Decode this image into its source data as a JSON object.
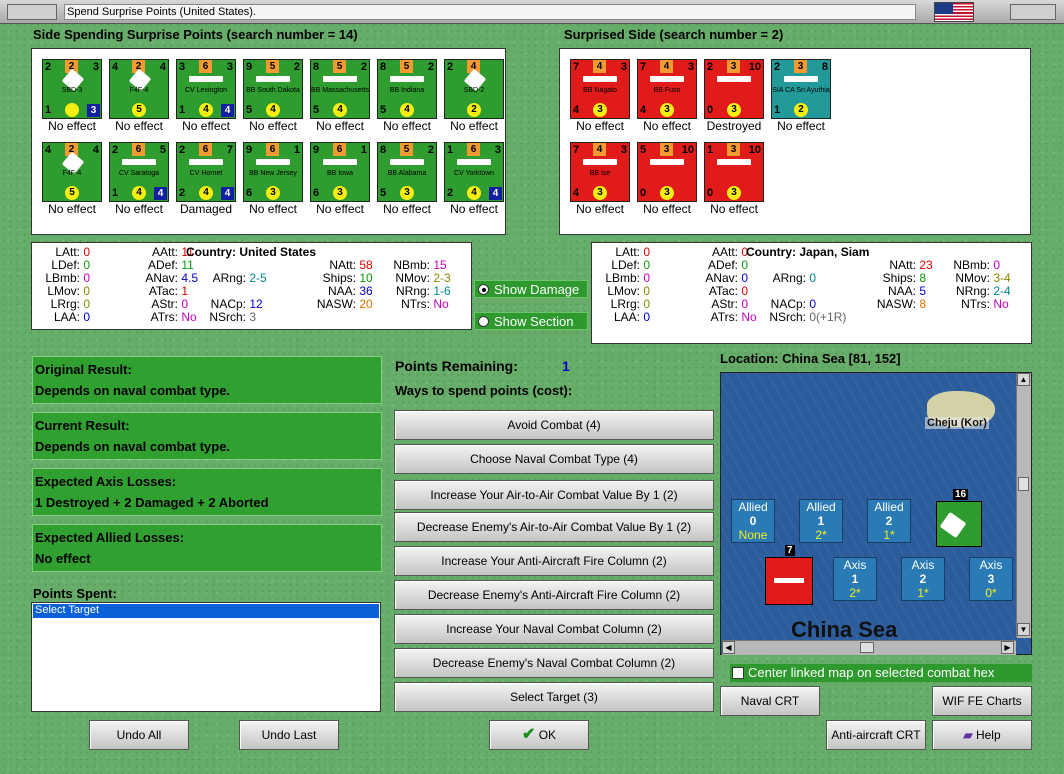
{
  "window": {
    "title": "Spend Surprise Points (United States)."
  },
  "spending": {
    "header": "Side Spending Surprise Points (search number = 14)"
  },
  "surprised": {
    "header": "Surprised Side (search number = 2)"
  },
  "spend_units": [
    {
      "color": "g",
      "kind": "plane",
      "tl": "2",
      "tc": "2",
      "tr": "3",
      "bl": "1",
      "br": "",
      "name": "SBD-3",
      "extra": "3",
      "res": "No effect"
    },
    {
      "color": "g",
      "kind": "plane",
      "tl": "4",
      "tc": "2",
      "tr": "4",
      "bl": "",
      "br": "5",
      "name": "F4F-4",
      "extra": "",
      "res": "No effect"
    },
    {
      "color": "g",
      "kind": "ship",
      "tl": "3",
      "tc": "6",
      "tr": "3",
      "bl": "1",
      "br": "4",
      "name": "CV Lexington",
      "extra": "4",
      "res": "No effect"
    },
    {
      "color": "g",
      "kind": "ship",
      "tl": "9",
      "tc": "5",
      "tr": "2",
      "bl": "5",
      "br": "4",
      "name": "BB South Dakota",
      "extra": "",
      "res": "No effect"
    },
    {
      "color": "g",
      "kind": "ship",
      "tl": "8",
      "tc": "5",
      "tr": "2",
      "bl": "5",
      "br": "4",
      "name": "BB Massachusetts",
      "extra": "",
      "res": "No effect"
    },
    {
      "color": "g",
      "kind": "ship",
      "tl": "8",
      "tc": "5",
      "tr": "2",
      "bl": "5",
      "br": "4",
      "name": "BB Indiana",
      "extra": "",
      "res": "No effect"
    },
    {
      "color": "g",
      "kind": "plane",
      "tl": "2",
      "tc": "4",
      "tr": "",
      "bl": "",
      "br": "2",
      "name": "SBD-2",
      "extra": "",
      "res": "No effect"
    },
    {
      "color": "g",
      "kind": "plane",
      "tl": "4",
      "tc": "2",
      "tr": "4",
      "bl": "",
      "br": "5",
      "name": "F4F-4",
      "extra": "",
      "res": "No effect"
    },
    {
      "color": "g",
      "kind": "ship",
      "tl": "2",
      "tc": "6",
      "tr": "5",
      "bl": "1",
      "br": "4",
      "name": "CV Saratoga",
      "extra": "4",
      "res": "No effect"
    },
    {
      "color": "g",
      "kind": "ship",
      "tl": "2",
      "tc": "6",
      "tr": "7",
      "bl": "2",
      "br": "4",
      "name": "CV Hornet",
      "extra": "4",
      "res": "Damaged"
    },
    {
      "color": "g",
      "kind": "ship",
      "tl": "9",
      "tc": "6",
      "tr": "1",
      "bl": "6",
      "br": "3",
      "name": "BB New Jersey",
      "extra": "",
      "res": "No effect"
    },
    {
      "color": "g",
      "kind": "ship",
      "tl": "9",
      "tc": "6",
      "tr": "1",
      "bl": "6",
      "br": "3",
      "name": "BB Iowa",
      "extra": "",
      "res": "No effect"
    },
    {
      "color": "g",
      "kind": "ship",
      "tl": "8",
      "tc": "5",
      "tr": "2",
      "bl": "5",
      "br": "3",
      "name": "BB Alabama",
      "extra": "",
      "res": "No effect"
    },
    {
      "color": "g",
      "kind": "ship",
      "tl": "1",
      "tc": "6",
      "tr": "3",
      "bl": "2",
      "br": "4",
      "name": "CV Yorktown",
      "extra": "4",
      "res": "No effect"
    }
  ],
  "surprised_units": [
    {
      "color": "r",
      "kind": "ship",
      "tl": "7",
      "tc": "4",
      "tr": "3",
      "bl": "4",
      "br": "3",
      "name": "BB Nagato",
      "res": "No effect"
    },
    {
      "color": "r",
      "kind": "ship",
      "tl": "7",
      "tc": "4",
      "tr": "3",
      "bl": "4",
      "br": "3",
      "name": "BB Fuso",
      "res": "No effect"
    },
    {
      "color": "r",
      "kind": "ship",
      "tl": "2",
      "tc": "3",
      "tr": "10",
      "bl": "0",
      "br": "3",
      "name": "",
      "res": "Destroyed"
    },
    {
      "color": "t",
      "kind": "ship",
      "tl": "2",
      "tc": "3",
      "tr": "8",
      "bl": "1",
      "br": "2",
      "name": "SIA CA Sri Ayuthia",
      "res": "No effect"
    },
    {
      "color": "r",
      "kind": "ship",
      "tl": "7",
      "tc": "4",
      "tr": "3",
      "bl": "4",
      "br": "3",
      "name": "BB Ise",
      "res": "No effect"
    },
    {
      "color": "r",
      "kind": "ship",
      "tl": "5",
      "tc": "3",
      "tr": "10",
      "bl": "0",
      "br": "3",
      "name": "",
      "res": "No effect"
    },
    {
      "color": "r",
      "kind": "ship",
      "tl": "1",
      "tc": "3",
      "tr": "10",
      "bl": "0",
      "br": "3",
      "name": "",
      "res": "No effect"
    }
  ],
  "stats_us": {
    "country_label": "Country:",
    "country": "United States",
    "latt": "0",
    "ldef": "0",
    "lbmb": "0",
    "lmov": "0",
    "lrng": "0",
    "laa": "0",
    "aatt": "11",
    "adef": "11",
    "anav": "4.5",
    "atac": "1",
    "astr": "0",
    "atrs": "No",
    "arng": "2-5",
    "nacp": "12",
    "nsrch": "3",
    "natt": "58",
    "ships": "10",
    "naa": "36",
    "nasw": "20",
    "nbmb": "15",
    "nmov": "2-3",
    "nrng": "1-6",
    "ntrs": "No"
  },
  "stats_jp": {
    "country_label": "Country:",
    "country": "Japan, Siam",
    "latt": "0",
    "ldef": "0",
    "lbmb": "0",
    "lmov": "0",
    "lrng": "0",
    "laa": "0",
    "aatt": "0",
    "adef": "0",
    "anav": "0",
    "atac": "0",
    "astr": "0",
    "atrs": "No",
    "arng": "0",
    "nacp": "0",
    "nsrch": "0(+1R)",
    "natt": "23",
    "ships": "8",
    "naa": "5",
    "nasw": "8",
    "nbmb": "0",
    "nmov": "3-4",
    "nrng": "2-4",
    "ntrs": "No"
  },
  "labels": {
    "latt": "LAtt:",
    "ldef": "LDef:",
    "lbmb": "LBmb:",
    "lmov": "LMov:",
    "lrng": "LRrg:",
    "laa": "LAA:",
    "aatt": "AAtt:",
    "adef": "ADef:",
    "anav": "ANav:",
    "atac": "ATac:",
    "astr": "AStr:",
    "atrs": "ATrs:",
    "arng": "ARng:",
    "nacp": "NACp:",
    "nsrch": "NSrch:",
    "natt": "NAtt:",
    "ships": "Ships:",
    "naa": "NAA:",
    "nasw": "NASW:",
    "nbmb": "NBmb:",
    "nmov": "NMov:",
    "nrng": "NRng:",
    "ntrs": "NTrs:"
  },
  "toggles": {
    "show_damage": "Show Damage",
    "show_section": "Show Section"
  },
  "results": {
    "original_label": "Original Result:",
    "original_value": "Depends on naval combat type.",
    "current_label": "Current Result:",
    "current_value": "Depends on naval combat type.",
    "axis_label": "Expected Axis Losses:",
    "axis_value": "1 Destroyed + 2 Damaged + 2 Aborted",
    "allied_label": "Expected Allied Losses:",
    "allied_value": "No effect"
  },
  "points": {
    "spent_label": "Points Spent:",
    "spent_items": [
      "Select Target"
    ],
    "remaining_label": "Points Remaining:",
    "remaining_value": "1",
    "ways_label": "Ways to spend points (cost):"
  },
  "options": [
    "Avoid Combat (4)",
    "Choose Naval Combat Type (4)",
    "Increase Your Air-to-Air Combat Value By 1 (2)",
    "Decrease Enemy's Air-to-Air Combat Value By 1 (2)",
    "Increase Your Anti-Aircraft Fire Column (2)",
    "Decrease Enemy's Anti-Aircraft Fire Column (2)",
    "Increase Your Naval Combat Column (2)",
    "Decrease Enemy's Naval Combat Column (2)",
    "Select Target (3)"
  ],
  "map": {
    "location": "Location: China Sea [81, 152]",
    "island": "Cheju (Kor)",
    "sea": "China Sea",
    "allied": [
      {
        "l": "Allied",
        "n": "0",
        "v": "None"
      },
      {
        "l": "Allied",
        "n": "1",
        "v": "2*"
      },
      {
        "l": "Allied",
        "n": "2",
        "v": "1*"
      }
    ],
    "axis": [
      {
        "l": "Axis",
        "n": "1",
        "v": "2*"
      },
      {
        "l": "Axis",
        "n": "2",
        "v": "1*"
      },
      {
        "l": "Axis",
        "n": "3",
        "v": "0*"
      }
    ],
    "stack_us": "16",
    "stack_jp": "7",
    "center_checkbox": "Center linked map on selected combat hex"
  },
  "buttons": {
    "undo_all": "Undo All",
    "undo_last": "Undo Last",
    "ok": "OK",
    "naval_crt": "Naval CRT",
    "wif_charts": "WIF FE Charts",
    "aa_crt": "Anti-aircraft CRT",
    "help": "Help"
  }
}
